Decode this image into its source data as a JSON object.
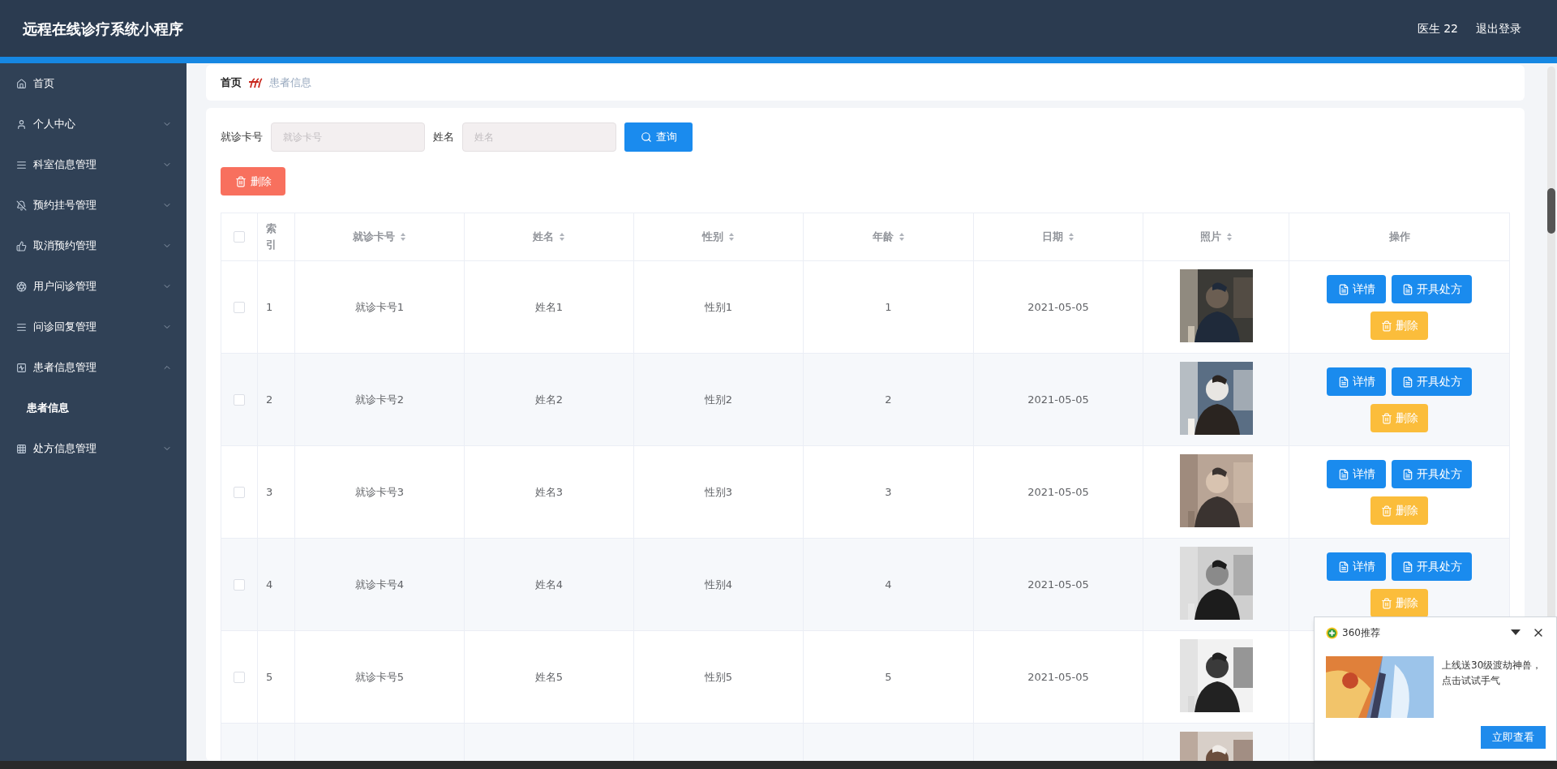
{
  "header": {
    "title": "远程在线诊疗系统小程序",
    "user": "医生 22",
    "logout": "退出登录"
  },
  "sidebar": {
    "items": [
      {
        "label": "首页",
        "kind": "link"
      },
      {
        "label": "个人中心",
        "kind": "menu",
        "expanded": false
      },
      {
        "label": "科室信息管理",
        "kind": "menu",
        "expanded": false
      },
      {
        "label": "预约挂号管理",
        "kind": "menu",
        "expanded": false
      },
      {
        "label": "取消预约管理",
        "kind": "menu",
        "expanded": false
      },
      {
        "label": "用户问诊管理",
        "kind": "menu",
        "expanded": false
      },
      {
        "label": "问诊回复管理",
        "kind": "menu",
        "expanded": false
      },
      {
        "label": "患者信息管理",
        "kind": "menu",
        "expanded": true,
        "children": [
          {
            "label": "患者信息"
          }
        ]
      },
      {
        "label": "处方信息管理",
        "kind": "menu",
        "expanded": false
      }
    ]
  },
  "breadcrumb": [
    "首页",
    "患者信息"
  ],
  "search": {
    "fields": [
      {
        "label": "就诊卡号",
        "placeholder": "就诊卡号"
      },
      {
        "label": "姓名",
        "placeholder": "姓名"
      }
    ],
    "button": "查询"
  },
  "toolbar": {
    "delete": "删除"
  },
  "table": {
    "header_checked": false,
    "columns": [
      {
        "label": "索引",
        "sortable": false
      },
      {
        "label": "就诊卡号",
        "sortable": true
      },
      {
        "label": "姓名",
        "sortable": true
      },
      {
        "label": "性别",
        "sortable": true
      },
      {
        "label": "年龄",
        "sortable": true
      },
      {
        "label": "日期",
        "sortable": true
      },
      {
        "label": "照片",
        "sortable": true
      },
      {
        "label": "操作",
        "sortable": false
      }
    ],
    "rows": [
      {
        "checked": false,
        "cells": [
          "1",
          "就诊卡号1",
          "姓名1",
          "性别1",
          "1",
          "2021-05-05"
        ],
        "photo": {
          "kind": "picture"
        },
        "actions": [
          {
            "kind": "detail",
            "label": "详情"
          },
          {
            "kind": "prescribe",
            "label": "开具处方"
          },
          {
            "kind": "delete",
            "label": "删除"
          }
        ]
      },
      {
        "checked": false,
        "cells": [
          "2",
          "就诊卡号2",
          "姓名2",
          "性别2",
          "2",
          "2021-05-05"
        ],
        "photo": {
          "kind": "picture"
        },
        "actions": [
          {
            "kind": "detail",
            "label": "详情"
          },
          {
            "kind": "prescribe",
            "label": "开具处方"
          },
          {
            "kind": "delete",
            "label": "删除"
          }
        ]
      },
      {
        "checked": false,
        "cells": [
          "3",
          "就诊卡号3",
          "姓名3",
          "性别3",
          "3",
          "2021-05-05"
        ],
        "photo": {
          "kind": "picture"
        },
        "actions": [
          {
            "kind": "detail",
            "label": "详情"
          },
          {
            "kind": "prescribe",
            "label": "开具处方"
          },
          {
            "kind": "delete",
            "label": "删除"
          }
        ]
      },
      {
        "checked": false,
        "cells": [
          "4",
          "就诊卡号4",
          "姓名4",
          "性别4",
          "4",
          "2021-05-05"
        ],
        "photo": {
          "kind": "picture"
        },
        "actions": [
          {
            "kind": "detail",
            "label": "详情"
          },
          {
            "kind": "prescribe",
            "label": "开具处方"
          },
          {
            "kind": "delete",
            "label": "删除"
          }
        ]
      },
      {
        "checked": false,
        "cells": [
          "5",
          "就诊卡号5",
          "姓名5",
          "性别5",
          "5",
          "2021-05-05"
        ],
        "photo": {
          "kind": "picture"
        }
      },
      {
        "photo": {
          "kind": "picture"
        }
      }
    ]
  },
  "popup": {
    "source": "360推荐",
    "message": "上线送30级渡劫神兽，点击试试手气",
    "button": "立即查看"
  }
}
